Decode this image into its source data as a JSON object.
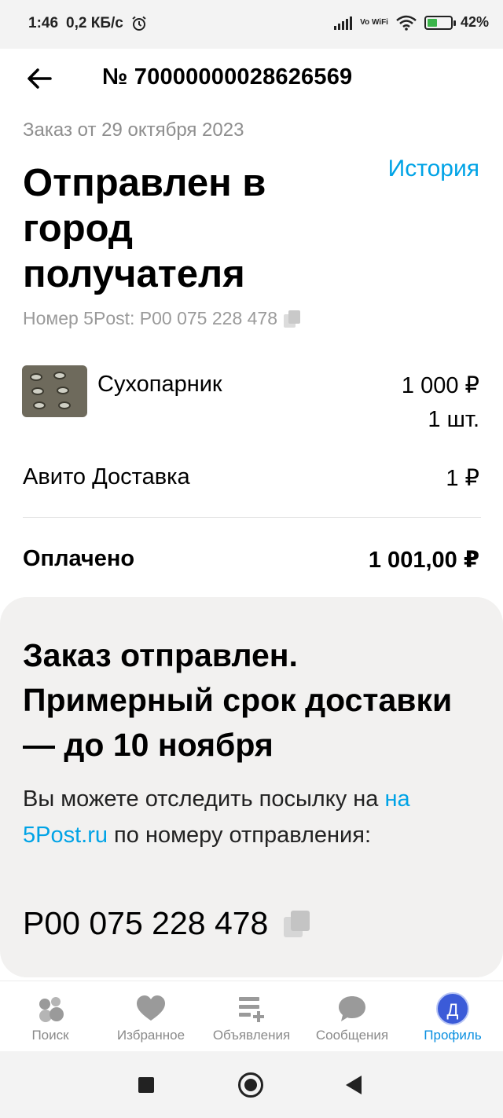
{
  "status_bar": {
    "time": "1:46",
    "speed": "0,2 КБ/с",
    "network_label": "Vo WiFi",
    "battery": "42%",
    "icons": [
      "alarm-icon",
      "signal-icon",
      "wifi-icon",
      "battery-icon"
    ]
  },
  "header": {
    "back_icon": "arrow-left-icon",
    "order_number": "№ 70000000028626569"
  },
  "order": {
    "date": "Заказ от 29 октября 2023",
    "history_link": "История",
    "status": "Отправлен в город получателя",
    "tracking_label": "Номер 5Post: Р00 075 228 478"
  },
  "item": {
    "name": "Сухопарник",
    "price": "1 000 ₽",
    "quantity": "1 шт."
  },
  "delivery": {
    "label": "Авито Доставка",
    "price": "1 ₽"
  },
  "paid": {
    "label": "Оплачено",
    "value": "1 001,00 ₽"
  },
  "info_card": {
    "title": "Заказ отправлен. Примерный срок доставки — до 10 ноября",
    "text_before": "Вы можете отследить посылку на ",
    "link": "на 5Post.ru",
    "text_after": " по номеру отправления:",
    "tracking": "Р00 075 228 478"
  },
  "bottom_nav": [
    {
      "label": "Поиск",
      "icon": "search-bubbles-icon"
    },
    {
      "label": "Избранное",
      "icon": "heart-icon"
    },
    {
      "label": "Объявления",
      "icon": "list-add-icon"
    },
    {
      "label": "Сообщения",
      "icon": "chat-icon"
    },
    {
      "label": "Профиль",
      "icon": "avatar-icon",
      "avatar_letter": "Д",
      "active": true
    }
  ],
  "colors": {
    "accent": "#00a3e6",
    "active_nav": "#0a8fe0",
    "card_bg": "#f2f1f0",
    "muted": "#8e8e8e"
  }
}
